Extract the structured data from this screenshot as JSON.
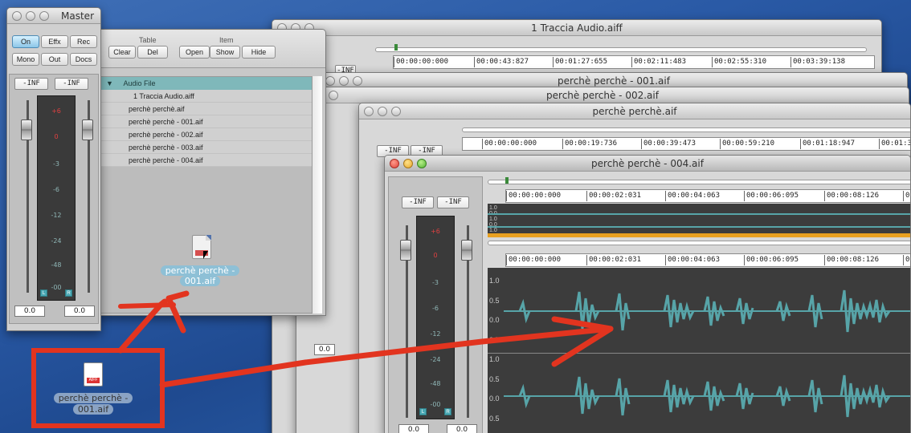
{
  "master": {
    "title": "Master",
    "buttons": [
      "On",
      "Effx",
      "Rec",
      "Mono",
      "Out",
      "Docs"
    ],
    "peak_left": "-INF",
    "peak_right": "-INF",
    "scale": [
      "+6",
      "0",
      "-3",
      "-6",
      "-12",
      "-24",
      "-48",
      "-00"
    ],
    "meter_l": "L",
    "meter_r": "R",
    "value_left": "0.0",
    "value_right": "0.0"
  },
  "browser": {
    "group_table": "Table",
    "group_item": "Item",
    "btn_clear": "Clear",
    "btn_del": "Del",
    "btn_open": "Open",
    "btn_show": "Show",
    "btn_hide": "Hide",
    "header": "Audio File",
    "files": [
      "1 Traccia Audio.aiff",
      "perchè perchè.aif",
      "perchè perchè - 001.aif",
      "perchè perchè - 002.aif",
      "perchè perchè - 003.aif",
      "perchè perchè - 004.aif"
    ],
    "drag_label_1": "perchè perchè -",
    "drag_label_2": "001.aif"
  },
  "win1": {
    "title": "1 Traccia Audio.aiff",
    "inf": "-INF",
    "ruler": [
      "00:00:00:000",
      "00:00:43:827",
      "00:01:27:655",
      "00:02:11:483",
      "00:02:55:310",
      "00:03:39:138"
    ]
  },
  "win2": {
    "title": "perchè perchè - 001.aif"
  },
  "win3": {
    "title": "perchè perchè - 002.aif",
    "value": "0.0"
  },
  "win4": {
    "title": "perchè perchè.aif",
    "inf_left": "-INF",
    "inf_right": "-INF",
    "ruler": [
      "00:00:00:000",
      "00:00:19:736",
      "00:00:39:473",
      "00:00:59:210",
      "00:01:18:947",
      "00:01:3"
    ]
  },
  "front": {
    "title": "perchè perchè - 004.aif",
    "inf_left": "-INF",
    "inf_right": "-INF",
    "ruler": [
      "00:00:00:000",
      "00:00:02:031",
      "00:00:04:063",
      "00:00:06:095",
      "00:00:08:126",
      "0"
    ],
    "overview_scale": [
      "1.0",
      "0.0",
      "1.0",
      "0.0",
      "1.0"
    ],
    "amp_scale": [
      "1.0",
      "0.5",
      "0.0",
      "0.5",
      "1.0",
      "0.5",
      "0.0",
      "0.5",
      "1.0"
    ],
    "scale": [
      "+6",
      "0",
      "-3",
      "-6",
      "-12",
      "-24",
      "-48",
      "-00"
    ],
    "meter_l": "L",
    "meter_r": "R",
    "value_left": "0.0",
    "value_right": "0.0"
  },
  "desktop": {
    "icon_badge": "AIFF",
    "label_1": "perchè perchè -",
    "label_2": "001.aif"
  },
  "colors": {
    "desktop": "#2a5aa6",
    "waveform": "#57a4a8",
    "waveform_bg": "#3c3c3c",
    "selection_bar": "#e8a020",
    "annotation": "#e2341f",
    "list_header": "#7fb8ba"
  }
}
